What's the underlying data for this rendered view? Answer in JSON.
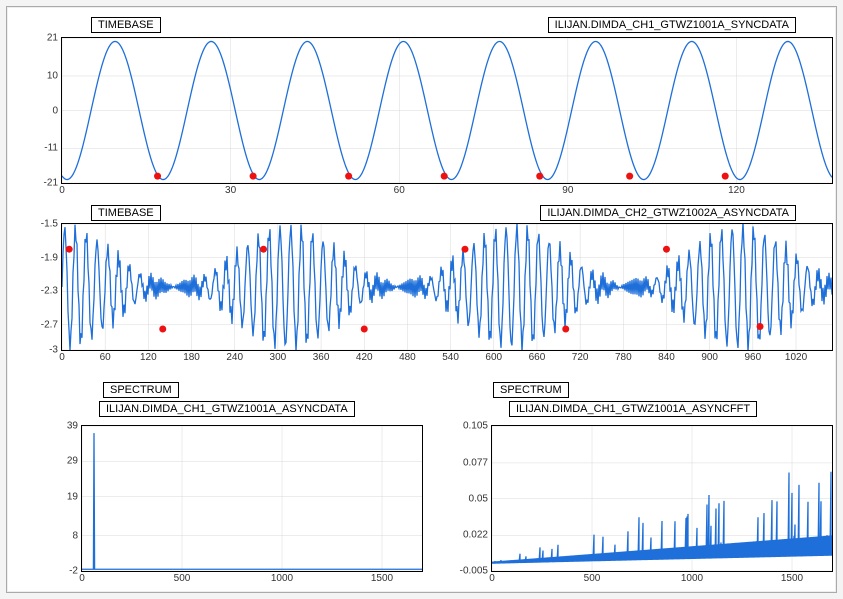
{
  "chart_data": [
    {
      "id": "chart1",
      "type": "line",
      "title": "TIMEBASE",
      "legend": "ILIJAN.DIMDA_CH1_GTWZ1001A_SYNCDATA",
      "xlim": [
        0,
        137
      ],
      "ylim": [
        -21,
        21
      ],
      "xticks": [
        0,
        30,
        60,
        90,
        120
      ],
      "yticks": [
        -21,
        -11,
        0,
        10,
        21
      ],
      "markers_x": [
        17,
        34,
        51,
        68,
        85,
        101,
        118
      ],
      "markers_y": [
        -19,
        -19,
        -19,
        -19,
        -19,
        -19,
        -19
      ],
      "sine": {
        "amplitude": 20,
        "offset": 0,
        "period": 17.1,
        "phase": -1.9
      },
      "color": "#1e6fd9",
      "marker_color": "#e11"
    },
    {
      "id": "chart2",
      "type": "line",
      "title": "TIMEBASE",
      "legend": "ILIJAN.DIMDA_CH2_GTWZ1002A_ASYNCDATA",
      "xlim": [
        0,
        1070
      ],
      "ylim": [
        -3.0,
        -1.5
      ],
      "xticks": [
        0,
        60,
        120,
        180,
        240,
        300,
        360,
        420,
        480,
        540,
        600,
        660,
        720,
        780,
        840,
        900,
        960,
        1020
      ],
      "yticks": [
        -3.0,
        -2.7,
        -2.3,
        -1.9,
        -1.5
      ],
      "markers_x": [
        10,
        140,
        280,
        420,
        560,
        700,
        840,
        970
      ],
      "markers_y": [
        -1.8,
        -2.75,
        -1.8,
        -2.75,
        -1.8,
        -2.75,
        -1.8,
        -2.72
      ],
      "dense": {
        "baseline": -2.25,
        "amp1": 0.7,
        "freq1": 0.42,
        "amp2": 0.1,
        "freq2": 2.2
      },
      "color": "#1e6fd9",
      "marker_color": "#e11"
    },
    {
      "id": "chart3",
      "type": "line",
      "title": "SPECTRUM",
      "legend": "ILIJAN.DIMDA_CH1_GTWZ1001A_ASYNCDATA",
      "xlim": [
        0,
        1700
      ],
      "ylim": [
        -2,
        39
      ],
      "xticks": [
        0,
        500,
        1000,
        1500
      ],
      "yticks": [
        -2,
        8,
        19,
        29,
        39
      ],
      "spectrum": {
        "baseline": -1.5,
        "peaks": [
          {
            "x": 60,
            "y": 37
          }
        ]
      },
      "color": "#1e6fd9"
    },
    {
      "id": "chart4",
      "type": "line",
      "title": "SPECTRUM",
      "legend": "ILIJAN.DIMDA_CH1_GTWZ1001A_ASYNCFFT",
      "xlim": [
        0,
        1700
      ],
      "ylim": [
        -0.005,
        0.105
      ],
      "xticks": [
        0,
        500,
        1000,
        1500
      ],
      "yticks": [
        -0.005,
        0.022,
        0.05,
        0.077,
        0.105
      ],
      "fft": true,
      "color": "#1e6fd9"
    }
  ],
  "layout": {
    "chart1": {
      "style": "left:54px; top:10px; width:770px; height:180px;",
      "plot": "left:0; top:20px; width:770px; height:145px;",
      "title_pos": "left:30px; top:0;",
      "legend_pos": "right:35px; top:0;"
    },
    "chart2": {
      "style": "left:54px; top:198px; width:770px; height:160px;",
      "plot": "left:0; top:18px; width:770px; height:126px;",
      "title_pos": "left:30px; top:0;",
      "legend_pos": "right:35px; top:0;"
    },
    "chart3": {
      "style": "left:74px; top:370px; width:340px; height:210px;",
      "plot": "left:0; top:48px; width:340px; height:145px;",
      "title_pos": "left:22px; top:5px;",
      "legend_pos": "left:18px; top:24px;"
    },
    "chart4": {
      "style": "left:484px; top:370px; width:340px; height:210px;",
      "plot": "left:0; top:48px; width:340px; height:145px;",
      "title_pos": "left:2px; top:5px;",
      "legend_pos": "left:18px; top:24px;"
    }
  }
}
